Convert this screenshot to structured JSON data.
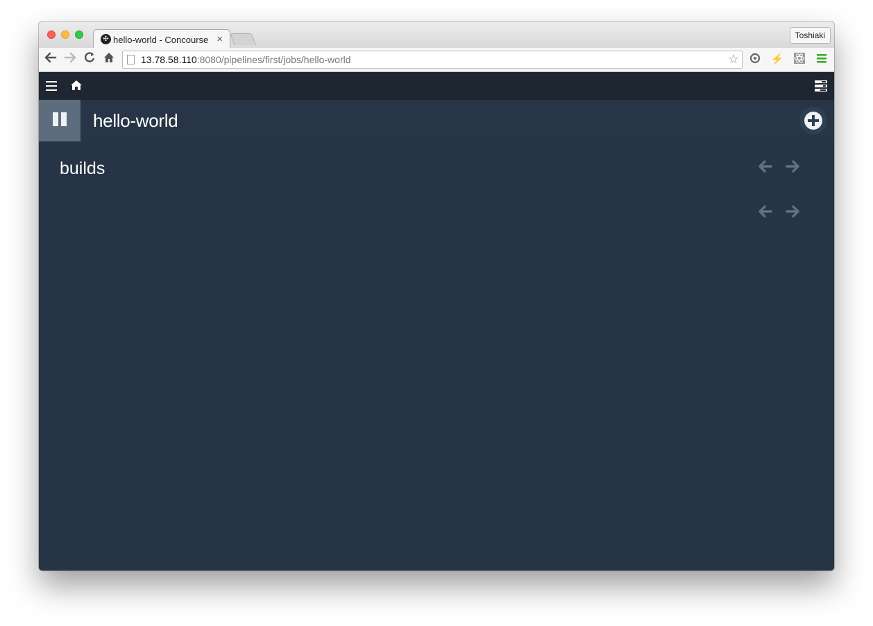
{
  "browser": {
    "tab_title": "hello-world - Concourse",
    "tab_close": "×",
    "profile_name": "Toshiaki",
    "url_host": "13.78.58.110",
    "url_rest": ":8080/pipelines/first/jobs/hello-world",
    "icons": {
      "back": "back-arrow-icon",
      "forward": "forward-arrow-icon",
      "reload": "reload-icon",
      "home": "home-icon",
      "bookmark": "star-icon",
      "menu": "chrome-menu-icon"
    }
  },
  "app": {
    "job_name": "hello-world",
    "section_title": "builds",
    "colors": {
      "topbar": "#1e2631",
      "background": "#263445",
      "pause_bg": "#5d6d7e",
      "pager_arrow": "#617181"
    },
    "pager_arrows": {
      "prev": "⇦",
      "next": "⇨"
    }
  }
}
